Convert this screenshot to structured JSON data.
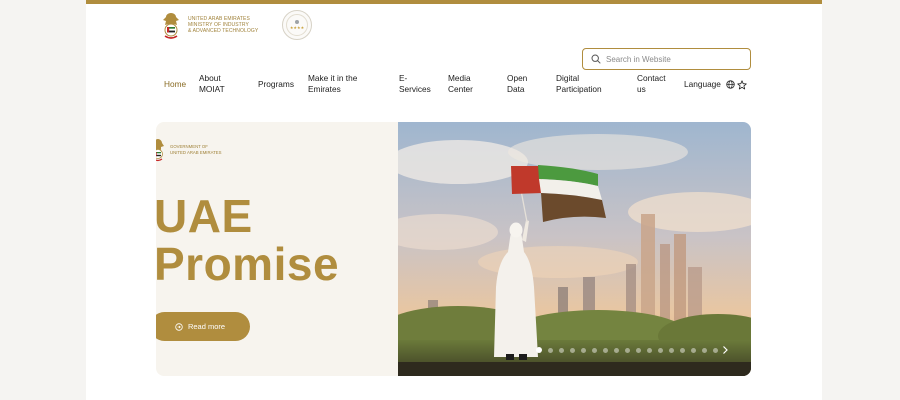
{
  "header": {
    "ministry_lines": [
      "United Arab Emirates",
      "Ministry of Industry",
      "& Advanced Technology"
    ],
    "search_placeholder": "Search in Website"
  },
  "nav": {
    "items": [
      {
        "id": "home",
        "lines": [
          "Home"
        ],
        "active": true
      },
      {
        "id": "about",
        "lines": [
          "About",
          "MOIAT"
        ]
      },
      {
        "id": "programs",
        "lines": [
          "Programs"
        ]
      },
      {
        "id": "make-it",
        "lines": [
          "Make it in the",
          "Emirates"
        ]
      },
      {
        "id": "e-services",
        "lines": [
          "E-",
          "Services"
        ]
      },
      {
        "id": "media",
        "lines": [
          "Media",
          "Center"
        ]
      },
      {
        "id": "open-data",
        "lines": [
          "Open",
          "Data"
        ]
      },
      {
        "id": "digital",
        "lines": [
          "Digital",
          "Participation"
        ]
      },
      {
        "id": "contact",
        "lines": [
          "Contact",
          "us"
        ]
      }
    ],
    "language_label": "Language"
  },
  "hero": {
    "gov_lines": [
      "Government of",
      "United Arab Emirates"
    ],
    "title_lines": [
      "UAE",
      "Promise"
    ],
    "read_more_label": "Read more",
    "slide_count": 17,
    "active_slide": 1
  },
  "colors": {
    "accent": "#b08d3e",
    "hero_bg": "#f7f4ee",
    "topbar": "#b08d3e"
  }
}
